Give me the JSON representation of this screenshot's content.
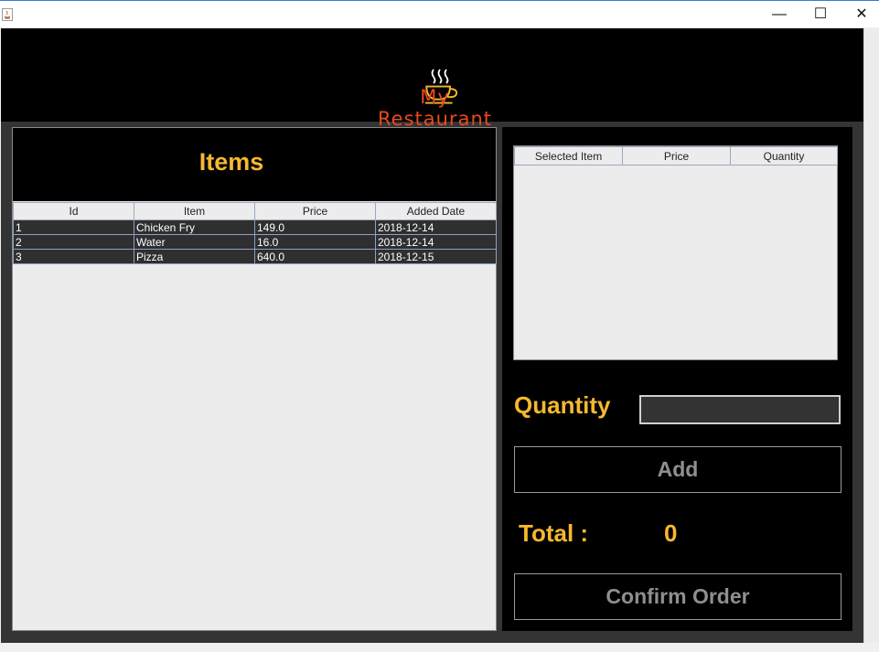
{
  "window": {
    "minimize": "—",
    "maximize": "☐",
    "close": "✕"
  },
  "brand": {
    "name": "My Restaurant",
    "accent_color": "#e8491d",
    "logo_icon": "coffee-cup-icon"
  },
  "items_panel": {
    "title": "Items",
    "columns": [
      "Id",
      "Item",
      "Price",
      "Added Date"
    ],
    "rows": [
      [
        "1",
        "Chicken Fry",
        "149.0",
        "2018-12-14"
      ],
      [
        "2",
        "Water",
        "16.0",
        "2018-12-14"
      ],
      [
        "3",
        "Pizza",
        "640.0",
        "2018-12-15"
      ]
    ]
  },
  "order_panel": {
    "columns": [
      "Selected Item",
      "Price",
      "Quantity"
    ],
    "quantity_label": "Quantity",
    "quantity_value": "",
    "add_label": "Add",
    "total_label": "Total :",
    "total_value": "0",
    "confirm_label": "Confirm Order"
  },
  "colors": {
    "label_yellow": "#f5b82e",
    "button_text": "#8f8f8f",
    "background": "#000000"
  }
}
